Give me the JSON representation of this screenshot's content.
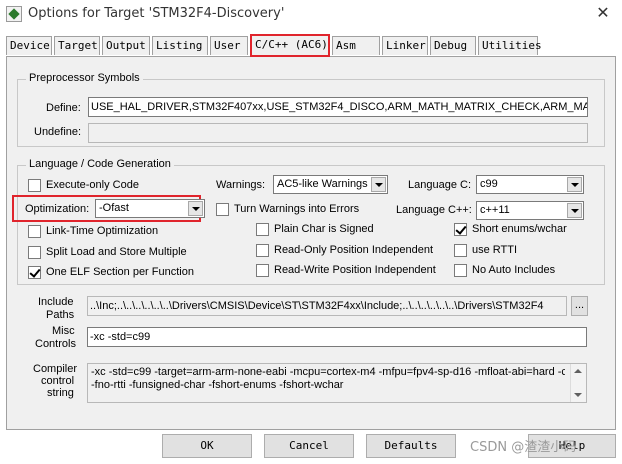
{
  "window": {
    "title": "Options for Target 'STM32F4-Discovery'",
    "close_glyph": "✕",
    "accent_color": "#e0242c"
  },
  "tabs": [
    {
      "label": "Device"
    },
    {
      "label": "Target"
    },
    {
      "label": "Output"
    },
    {
      "label": "Listing"
    },
    {
      "label": "User"
    },
    {
      "label": "C/C++ (AC6)",
      "active": true
    },
    {
      "label": "Asm"
    },
    {
      "label": "Linker"
    },
    {
      "label": "Debug"
    },
    {
      "label": "Utilities"
    }
  ],
  "preprocessor": {
    "title": "Preprocessor Symbols",
    "define_label": "Define:",
    "define_value": "USE_HAL_DRIVER,STM32F407xx,USE_STM32F4_DISCO,ARM_MATH_MATRIX_CHECK,ARM_MATH",
    "undefine_label": "Undefine:",
    "undefine_value": ""
  },
  "language": {
    "title": "Language / Code Generation",
    "execute_only": {
      "label": "Execute-only Code",
      "checked": false
    },
    "warnings_label": "Warnings:",
    "warnings_value": "AC5-like Warnings",
    "language_c_label": "Language C:",
    "language_c_value": "c99",
    "optimization_label": "Optimization:",
    "optimization_value": "-Ofast",
    "turn_warnings": {
      "label": "Turn Warnings into Errors",
      "checked": false
    },
    "language_cpp_label": "Language C++:",
    "language_cpp_value": "c++11",
    "lto": {
      "label": "Link-Time Optimization",
      "checked": false
    },
    "plain_char": {
      "label": "Plain Char is Signed",
      "checked": false
    },
    "short_enums": {
      "label": "Short enums/wchar",
      "checked": true
    },
    "split_load": {
      "label": "Split Load and Store Multiple",
      "checked": false
    },
    "ropi": {
      "label": "Read-Only Position Independent",
      "checked": false
    },
    "rtti": {
      "label": "use RTTI",
      "checked": false
    },
    "one_elf": {
      "label": "One ELF Section per Function",
      "checked": true
    },
    "rwpi": {
      "label": "Read-Write Position Independent",
      "checked": false
    },
    "no_auto_includes": {
      "label": "No Auto Includes",
      "checked": false
    }
  },
  "include_paths": {
    "label_line1": "Include",
    "label_line2": "Paths",
    "value": "..\\Inc;..\\..\\..\\..\\..\\..\\Drivers\\CMSIS\\Device\\ST\\STM32F4xx\\Include;..\\..\\..\\..\\..\\..\\Drivers\\STM32F4",
    "browse_label": "..."
  },
  "misc_controls": {
    "label_line1": "Misc",
    "label_line2": "Controls",
    "value": "-xc -std=c99"
  },
  "compiler_string": {
    "label_line1": "Compiler",
    "label_line2": "control",
    "label_line3": "string",
    "line1": "-xc -std=c99 -target=arm-arm-none-eabi -mcpu=cortex-m4 -mfpu=fpv4-sp-d16 -mfloat-abi=hard -c",
    "line2": "-fno-rtti -funsigned-char -fshort-enums -fshort-wchar"
  },
  "buttons": {
    "ok": "OK",
    "cancel": "Cancel",
    "defaults": "Defaults",
    "help": "Help"
  },
  "watermark": "CSDN @渣渣小码"
}
